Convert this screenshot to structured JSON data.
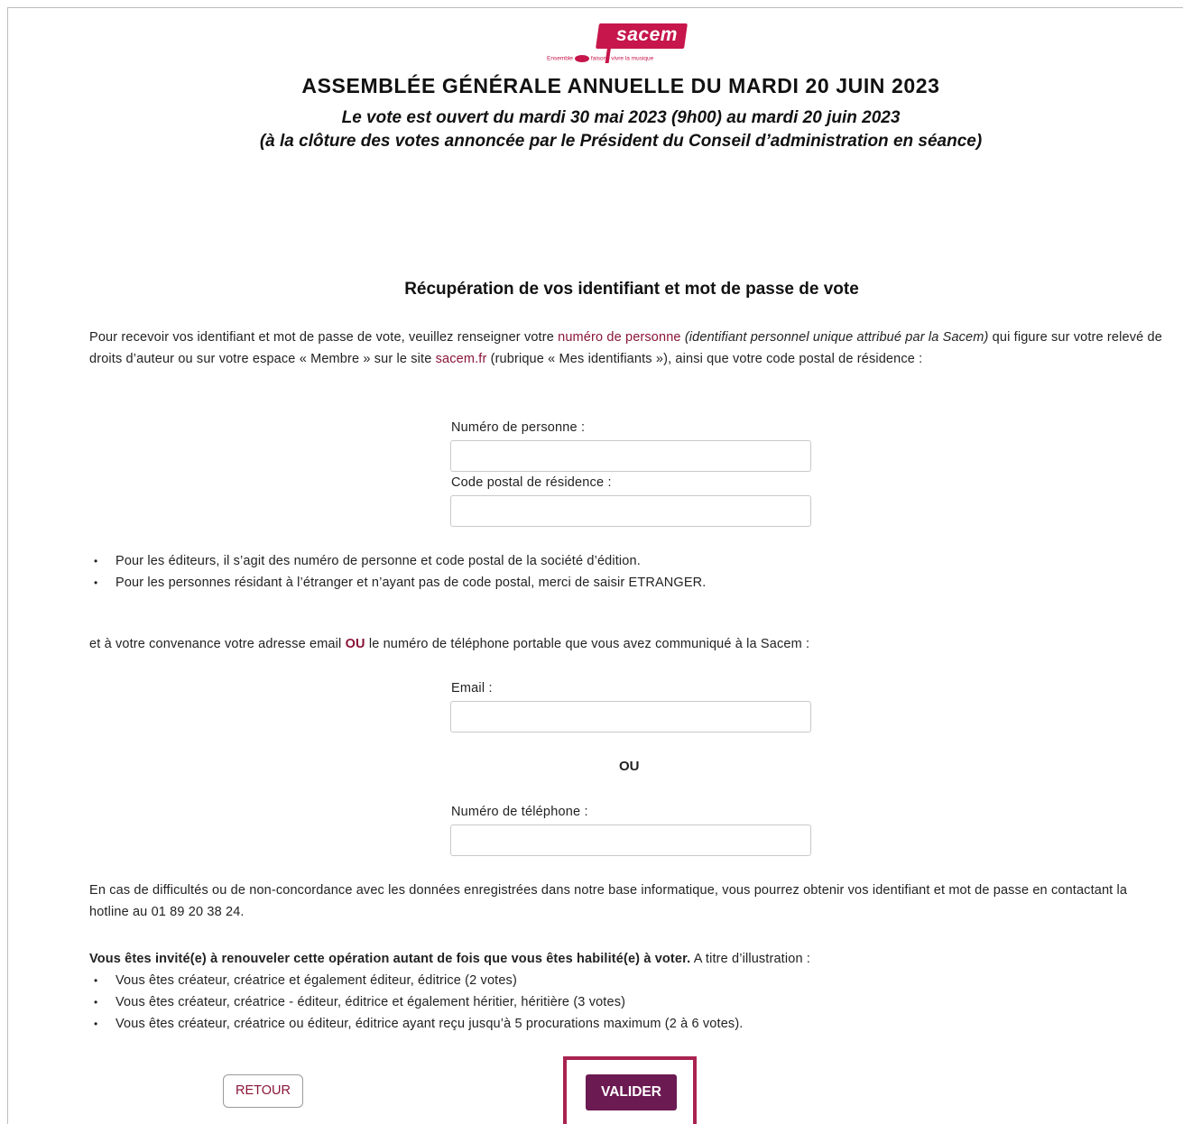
{
  "logo": {
    "brand": "sacem",
    "tagline_left": "Ensemble",
    "tagline_right": "faisons vivre la musique",
    "color": "#c6164b"
  },
  "header": {
    "title": "ASSEMBLÉE GÉNÉRALE ANNUELLE DU MARDI 20 JUIN 2023",
    "subtitle_line1": "Le vote est ouvert du mardi 30 mai 2023 (9h00) au mardi 20 juin 2023",
    "subtitle_line2": "(à la clôture des votes annoncée par le Président du Conseil d’administration en séance)"
  },
  "section": {
    "title": "Récupération de vos identifiant et mot de passe de vote"
  },
  "intro": {
    "part1": "Pour recevoir vos identifiant et mot de passe de vote, veuillez renseigner votre ",
    "highlight": "numéro de personne",
    "italic": " (identifiant personnel unique attribué par la Sacem)",
    "part2": " qui figure sur votre relevé de droits d’auteur ou sur votre espace « Membre » sur le site ",
    "link": "sacem.fr",
    "part3": " (rubrique « Mes identifiants »), ainsi que votre code postal de résidence :"
  },
  "form": {
    "person_label": "Numéro de personne :",
    "person_value": "",
    "postal_label": "Code postal de résidence :",
    "postal_value": "",
    "email_label": "Email :",
    "email_value": "",
    "or_label": "OU",
    "phone_label": "Numéro de téléphone :",
    "phone_value": ""
  },
  "notes": [
    "Pour les éditeurs, il s’agit des numéro de personne et code postal de la société d’édition.",
    "Pour les personnes résidant à l’étranger et n’ayant pas de code postal, merci de saisir ETRANGER."
  ],
  "contact": {
    "part1": "et à votre convenance votre adresse email ",
    "ou": "OU",
    "part2": " le numéro de téléphone portable que vous avez communiqué à la Sacem :"
  },
  "help": {
    "text": "En cas de difficultés ou de non-concordance avec les données enregistrées dans notre base informatique, vous pourrez obtenir vos identifiant et mot de passe en contactant la hotline au 01 89 20 38 24."
  },
  "repeat": {
    "bold": "Vous êtes invité(e) à renouveler cette opération autant de fois que vous êtes habilité(e) à voter.",
    "rest": " A titre d’illustration :",
    "examples": [
      "Vous êtes créateur, créatrice et également éditeur, éditrice (2 votes)",
      "Vous êtes créateur, créatrice - éditeur, éditrice et également héritier, héritière (3 votes)",
      "Vous êtes créateur, créatrice ou éditeur, éditrice ayant reçu jusqu’à 5 procurations maximum (2 à 6 votes)."
    ]
  },
  "buttons": {
    "back": "RETOUR",
    "submit": "VALIDER"
  },
  "colors": {
    "accent": "#8a1538",
    "submit_bg": "#6b1a52",
    "highlight_frame": "#a8234f"
  }
}
